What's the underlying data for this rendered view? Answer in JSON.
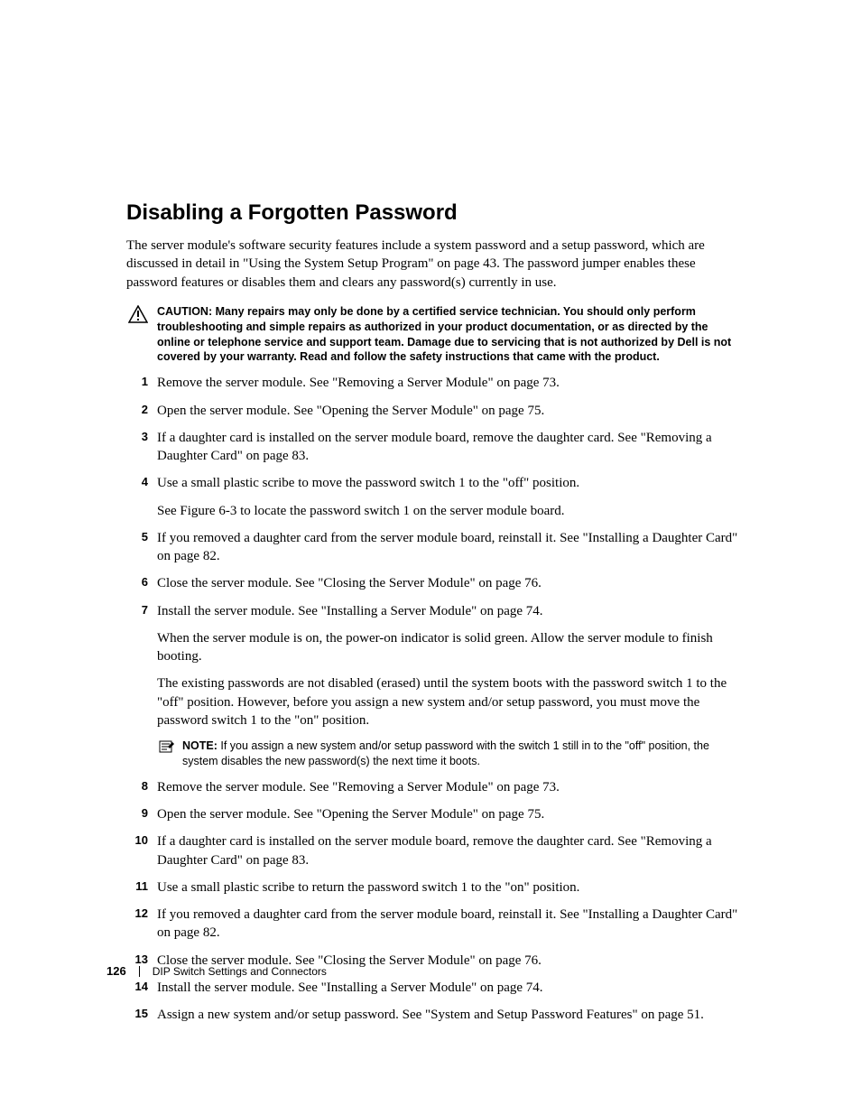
{
  "title": "Disabling a Forgotten Password",
  "intro": "The server module's software security features include a system password and a setup password, which are discussed in detail in \"Using the System Setup Program\" on page 43. The password jumper enables these password features or disables them and clears any password(s) currently in use.",
  "caution": {
    "lead": "CAUTION:",
    "text": "Many repairs may only be done by a certified service technician. You should only perform troubleshooting and simple repairs as authorized in your product documentation, or as directed by the online or telephone service and support team. Damage due to servicing that is not authorized by Dell is not covered by your warranty. Read and follow the safety instructions that came with the product."
  },
  "steps": [
    {
      "n": "1",
      "paras": [
        "Remove the server module. See \"Removing a Server Module\" on page 73."
      ]
    },
    {
      "n": "2",
      "paras": [
        "Open the server module. See \"Opening the Server Module\" on page 75."
      ]
    },
    {
      "n": "3",
      "paras": [
        "If a daughter card is installed on the server module board, remove the daughter card. See \"Removing a Daughter Card\" on page 83."
      ]
    },
    {
      "n": "4",
      "paras": [
        "Use a small plastic scribe to move the password switch 1 to the \"off\" position.",
        "See Figure 6-3 to locate the password switch 1 on the server module board."
      ]
    },
    {
      "n": "5",
      "paras": [
        "If you removed a daughter card from the server module board, reinstall it. See \"Installing a Daughter Card\" on page 82."
      ]
    },
    {
      "n": "6",
      "paras": [
        "Close the server module. See \"Closing the Server Module\" on page 76."
      ]
    },
    {
      "n": "7",
      "paras": [
        "Install the server module. See \"Installing a Server Module\" on page 74.",
        "When the server module is on, the power-on indicator is solid green. Allow the server module to finish booting.",
        "The existing passwords are not disabled (erased) until the system boots with the password switch 1 to the \"off\" position. However, before you assign a new system and/or setup password, you must move the password switch 1 to the \"on\" position."
      ],
      "note": {
        "lead": "NOTE:",
        "text": "If you assign a new system and/or setup password with the switch 1 still in to the \"off\" position, the system disables the new password(s) the next time it boots."
      }
    },
    {
      "n": "8",
      "paras": [
        "Remove the server module. See \"Removing a Server Module\" on page 73."
      ]
    },
    {
      "n": "9",
      "paras": [
        "Open the server module. See \"Opening the Server Module\" on page 75."
      ]
    },
    {
      "n": "10",
      "paras": [
        "If a daughter card is installed on the server module board, remove the daughter card. See \"Removing a Daughter Card\" on page 83."
      ]
    },
    {
      "n": "11",
      "paras": [
        "Use a small plastic scribe to return the password switch 1 to the \"on\" position."
      ]
    },
    {
      "n": "12",
      "paras": [
        "If you removed a daughter card from the server module board, reinstall it. See \"Installing a Daughter Card\" on page 82."
      ]
    },
    {
      "n": "13",
      "paras": [
        "Close the server module. See \"Closing the Server Module\" on page 76."
      ]
    },
    {
      "n": "14",
      "paras": [
        "Install the server module. See \"Installing a Server Module\" on page 74."
      ]
    },
    {
      "n": "15",
      "paras": [
        "Assign a new system and/or setup password. See \"System and Setup Password Features\" on page 51."
      ]
    }
  ],
  "footer": {
    "page": "126",
    "section": "DIP Switch Settings and Connectors"
  }
}
